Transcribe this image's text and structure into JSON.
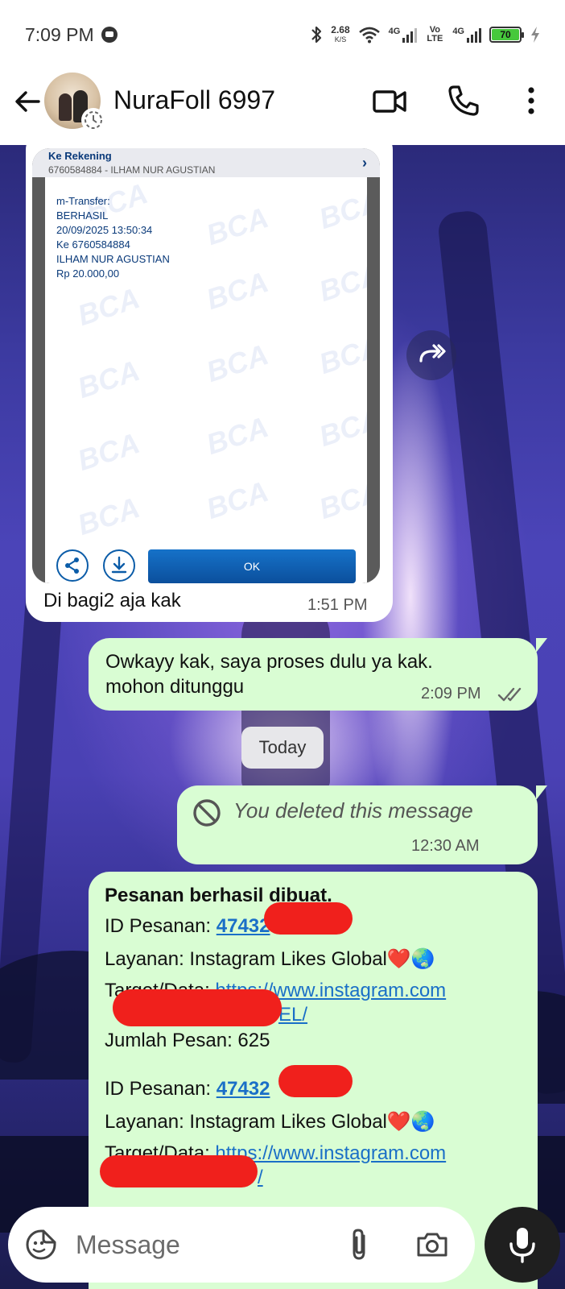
{
  "status_bar": {
    "time": "7:09 PM",
    "net_speed_value": "2.68",
    "net_speed_unit": "K/S",
    "sim1_label": "4G",
    "volte_label": "Vo LTE",
    "sim2_label": "4G",
    "battery": "70"
  },
  "header": {
    "contact_name": "NuraFoll 6997"
  },
  "messages": {
    "receipt": {
      "to_account_label": "Ke Rekening",
      "to_account_value": "6760584884 - ILHAM NUR AGUSTIAN",
      "lines": [
        "m-Transfer:",
        "BERHASIL",
        "20/09/2025 13:50:34",
        "Ke 6760584884",
        "ILHAM NUR AGUSTIAN",
        "Rp 20.000,00"
      ],
      "watermark": "BCA",
      "ok_label": "OK",
      "caption": "Di bagi2 aja kak",
      "time": "1:51 PM"
    },
    "reply": {
      "line1": "Owkayy kak, saya proses dulu ya kak.",
      "line2": "mohon ditunggu",
      "time": "2:09 PM"
    },
    "day_divider": "Today",
    "deleted": {
      "text": "You deleted this message",
      "time": "12:30 AM"
    },
    "order": {
      "title": "Pesanan berhasil dibuat.",
      "id_label": "ID Pesanan: ",
      "id_visible": "47432",
      "service_label": "Layanan: Instagram Likes Global",
      "service_emoji": "❤️🌏",
      "target_label": "Target/Data: ",
      "link_text": "https://www.instagram.com",
      "link_cont1": "EL/",
      "link_cont2": "/",
      "qty_label": "Jumlah Pesan: 625"
    }
  },
  "input": {
    "placeholder": "Message"
  },
  "colors": {
    "outgoing_bubble": "#d9fdd3",
    "incoming_bubble": "#ffffff",
    "link": "#1a6fc7",
    "redaction": "#f0201c"
  }
}
